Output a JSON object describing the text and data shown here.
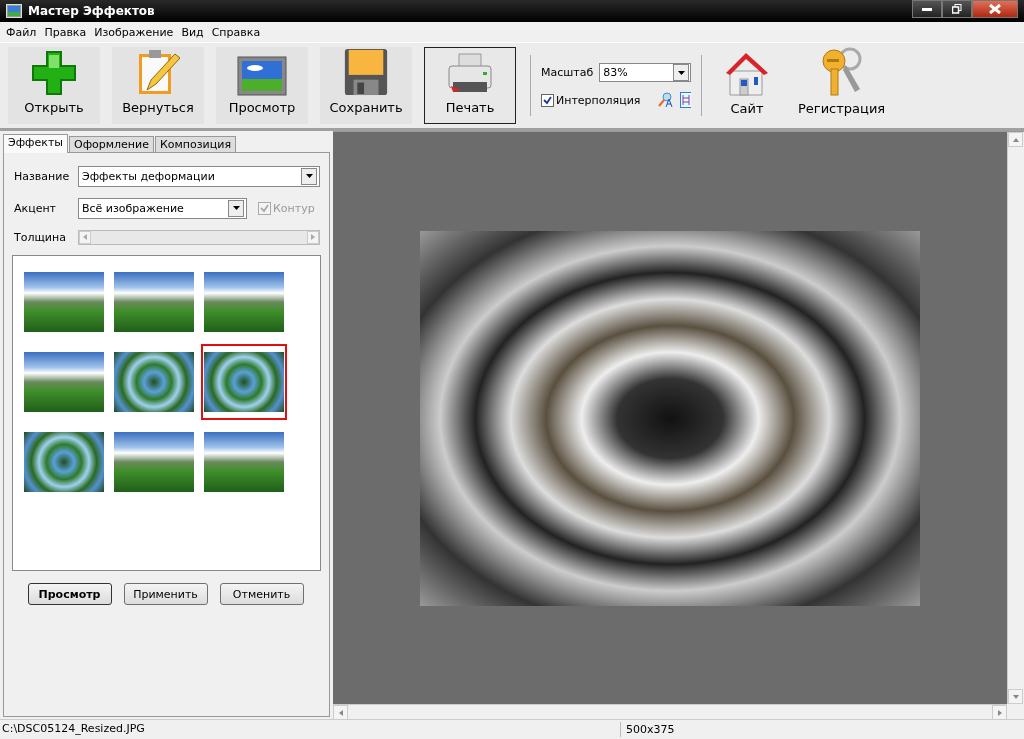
{
  "window": {
    "title": "Мастер Эффектов"
  },
  "menu": [
    "Файл",
    "Правка",
    "Изображение",
    "Вид",
    "Справка"
  ],
  "toolbar": {
    "buttons": [
      {
        "label": "Открыть",
        "pressed": false
      },
      {
        "label": "Вернуться",
        "pressed": false
      },
      {
        "label": "Просмотр",
        "pressed": false
      },
      {
        "label": "Сохранить",
        "pressed": false
      },
      {
        "label": "Печать",
        "pressed": true
      }
    ],
    "zoom": {
      "label": "Масштаб",
      "value": "83%"
    },
    "interpolation": {
      "label": "Интерполяция",
      "checked": true
    },
    "links": [
      {
        "label": "Сайт"
      },
      {
        "label": "Регистрация"
      }
    ]
  },
  "panel": {
    "tabs": [
      {
        "label": "Эффекты",
        "selected": true
      },
      {
        "label": "Оформление",
        "selected": false
      },
      {
        "label": "Композиция",
        "selected": false
      }
    ],
    "name": {
      "label": "Название",
      "value": "Эффекты деформации"
    },
    "accent": {
      "label": "Акцент",
      "value": "Всё изображение"
    },
    "contour": {
      "label": "Контур",
      "checked": true,
      "disabled": true
    },
    "thickness": {
      "label": "Толщина",
      "disabled": true
    },
    "thumbnails": [
      {
        "kind": "landscape",
        "selected": false
      },
      {
        "kind": "landscape",
        "selected": false
      },
      {
        "kind": "landscape",
        "selected": false
      },
      {
        "kind": "landscape",
        "selected": false
      },
      {
        "kind": "swirl",
        "selected": false
      },
      {
        "kind": "swirl",
        "selected": true
      },
      {
        "kind": "swirl",
        "selected": false
      },
      {
        "kind": "landscape",
        "selected": false
      },
      {
        "kind": "landscape",
        "selected": false
      }
    ],
    "buttons": [
      {
        "label": "Просмотр",
        "default": true
      },
      {
        "label": "Применить",
        "default": false
      },
      {
        "label": "Отменить",
        "default": false
      }
    ]
  },
  "status_bar": {
    "path": "C:\\DSC05124_Resized.JPG",
    "size": "500x375"
  }
}
